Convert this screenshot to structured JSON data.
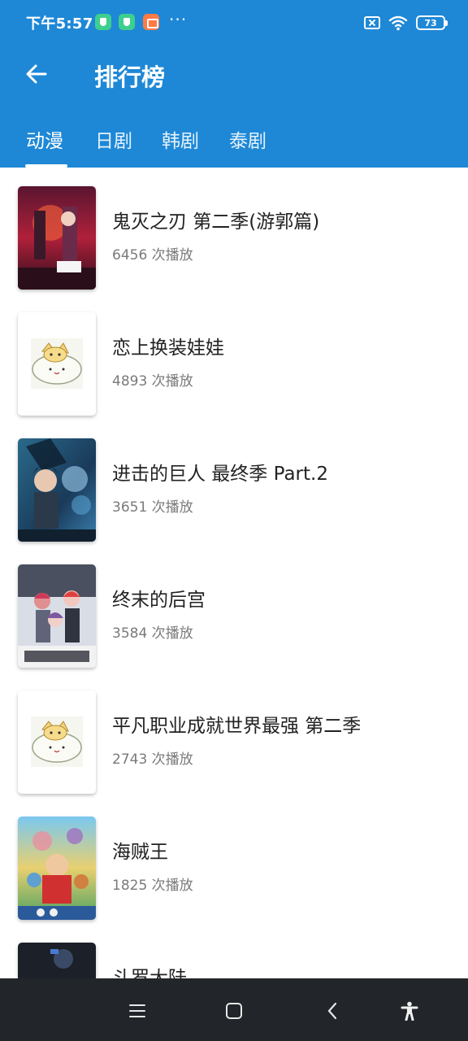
{
  "status_bar": {
    "time": "下午5:57",
    "more": "···",
    "battery": "73",
    "icons": [
      "shield-icon",
      "shield-icon",
      "app-icon",
      "sim-off-icon",
      "wifi-icon",
      "battery-icon"
    ]
  },
  "toolbar": {
    "back_icon": "arrow-left-icon",
    "title": "排行榜"
  },
  "tabs": [
    {
      "label": "动漫",
      "selected": true
    },
    {
      "label": "日剧",
      "selected": false
    },
    {
      "label": "韩剧",
      "selected": false
    },
    {
      "label": "泰剧",
      "selected": false
    }
  ],
  "colors": {
    "header": "#1e88d6",
    "navbar": "#222529"
  },
  "items": [
    {
      "title": "鬼灭之刃 第二季(游郭篇)",
      "plays": "6456 次播放",
      "poster": "poster-demon-slayer"
    },
    {
      "title": "恋上换装娃娃",
      "plays": "4893 次播放",
      "poster": "placeholder-mascot"
    },
    {
      "title": "进击的巨人 最终季 Part.2",
      "plays": "3651 次播放",
      "poster": "poster-attack-on-titan"
    },
    {
      "title": "终末的后宫",
      "plays": "3584 次播放",
      "poster": "poster-world-end-harem"
    },
    {
      "title": "平凡职业成就世界最强 第二季",
      "plays": "2743 次播放",
      "poster": "placeholder-mascot"
    },
    {
      "title": "海贼王",
      "plays": "1825 次播放",
      "poster": "poster-one-piece"
    },
    {
      "title": "斗罗大陆",
      "plays": "",
      "poster": "poster-douluo"
    }
  ],
  "navbar": {
    "icons": [
      "menu-icon",
      "home-square-icon",
      "back-chevron-icon",
      "accessibility-icon"
    ]
  }
}
